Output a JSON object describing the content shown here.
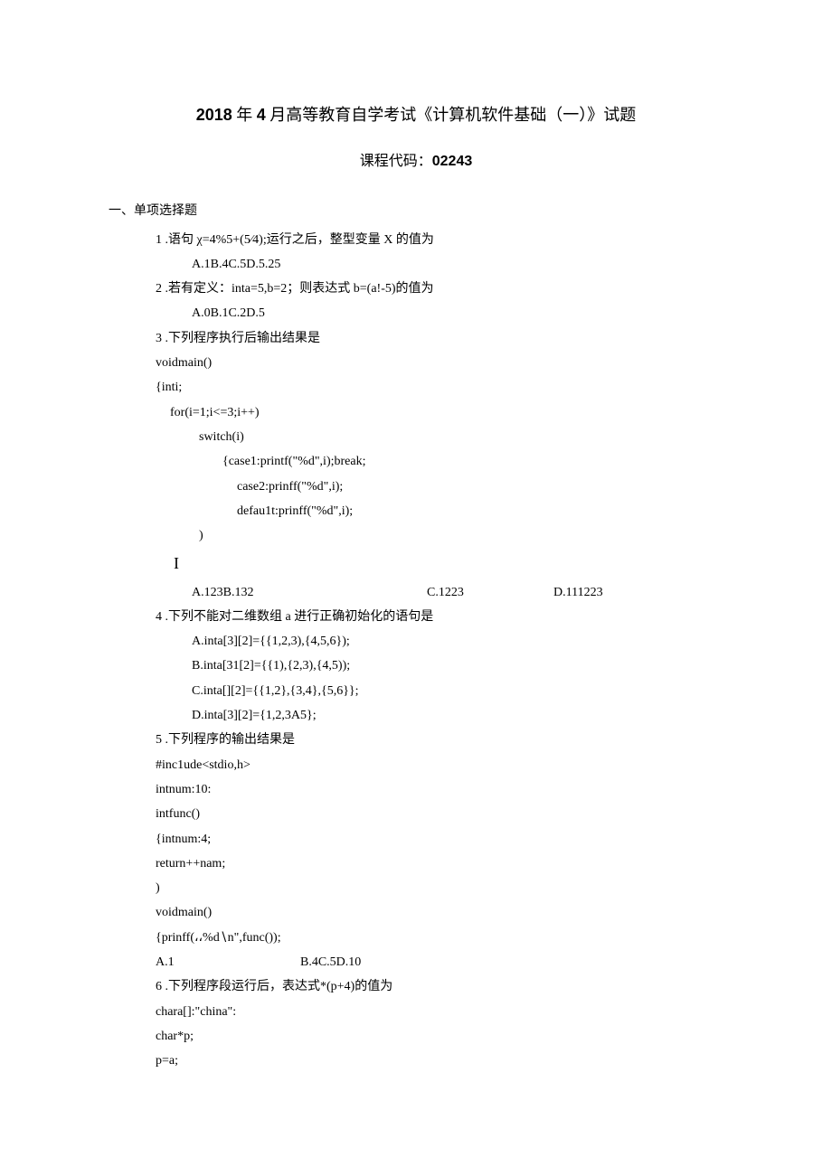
{
  "title": {
    "bold_prefix": "2018",
    "mid1": " 年 ",
    "bold_month": "4",
    "rest": " 月高等教育自学考试《计算机软件基础（一）》试题"
  },
  "subtitle": {
    "label": "课程代码：",
    "code": "02243"
  },
  "section1_heading": "一、单项选择题",
  "q1": {
    "stem": "1 .语句 χ=4%5+(5⁄4);运行之后，整型变量 X 的值为",
    "opts": "A.1B.4C.5D.5.25"
  },
  "q2": {
    "stem": "2 .若有定义：inta=5,b=2；则表达式 b=(a!-5)的值为",
    "opts": "A.0B.1C.2D.5"
  },
  "q3": {
    "stem": "3 .下列程序执行后输出结果是",
    "c1": "voidmain()",
    "c2": "{inti;",
    "c3": "for(i=1;i<=3;i++)",
    "c4": "switch(i)",
    "c5": "{case1:printf(\"%d\",i);break;",
    "c6": "case2:prinff(\"%d\",i);",
    "c7": "defau1t:prinff(\"%d\",i);",
    "c8": ")",
    "c9": "I",
    "optA": "A.123B.132",
    "optC": "C.1223",
    "optD": "D.111223"
  },
  "q4": {
    "stem": "4 .下列不能对二维数组 a 进行正确初始化的语句是",
    "a": "A.inta[3][2]={{1,2,3),{4,5,6});",
    "b": "B.inta[31[2]={{1),{2,3),{4,5));",
    "c": "C.inta[][2]={{1,2},{3,4},{5,6}};",
    "d": "D.inta[3][2]={1,2,3A5};"
  },
  "q5": {
    "stem": "5 .下列程序的输出结果是",
    "c1": "#inc1ude<stdio,h>",
    "c2": "intnum:10:",
    "c3": "intfunc()",
    "c4": "{intnum:4;",
    "c5": " return++nam;",
    "c6": ")",
    "c7": "voidmain()",
    "c8": "{prinff(،،%d∖n\",func());",
    "optA": "A.1",
    "optRest": "B.4C.5D.10"
  },
  "q6": {
    "stem": "6 .下列程序段运行后，表达式*(p+4)的值为",
    "c1": "chara[]:\"china\":",
    "c2": "char*p;",
    "c3": "p=a;"
  }
}
